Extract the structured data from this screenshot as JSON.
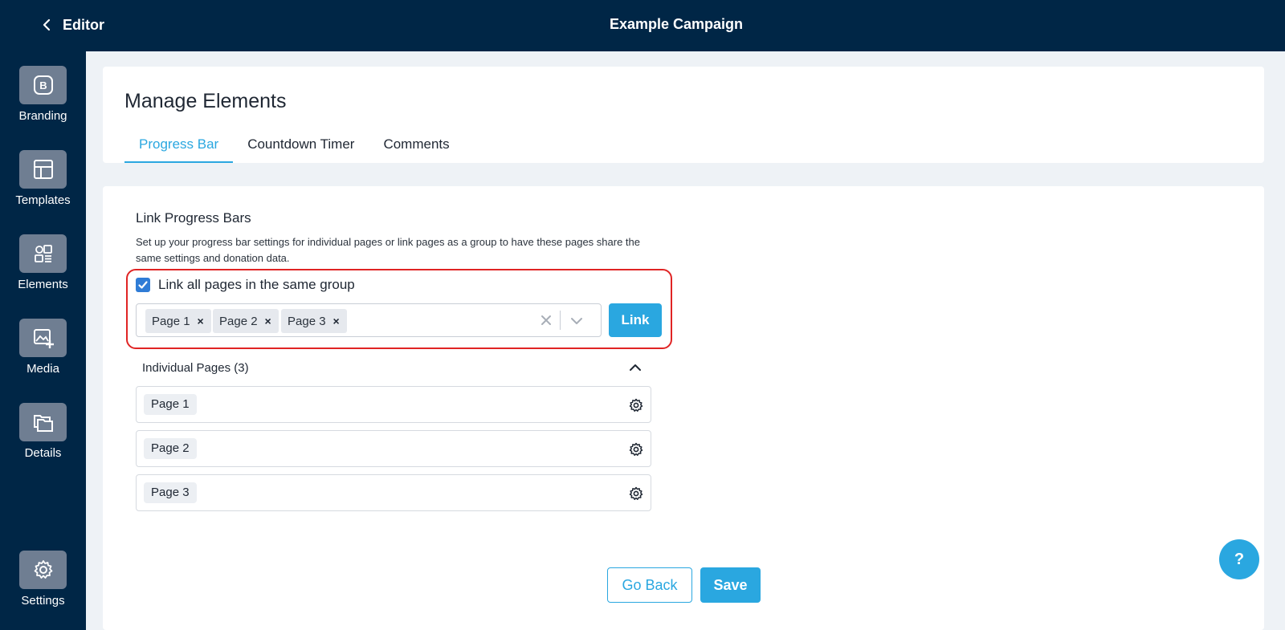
{
  "topbar": {
    "back_label": "Editor",
    "title": "Example Campaign"
  },
  "sidebar": {
    "items": [
      {
        "label": "Branding",
        "icon": "branding-icon"
      },
      {
        "label": "Templates",
        "icon": "templates-icon"
      },
      {
        "label": "Elements",
        "icon": "elements-icon"
      },
      {
        "label": "Media",
        "icon": "media-icon"
      },
      {
        "label": "Details",
        "icon": "details-icon"
      },
      {
        "label": "Settings",
        "icon": "gear-icon"
      }
    ]
  },
  "header": {
    "title": "Manage Elements",
    "tabs": [
      {
        "label": "Progress Bar",
        "active": true
      },
      {
        "label": "Countdown Timer",
        "active": false
      },
      {
        "label": "Comments",
        "active": false
      }
    ]
  },
  "link_section": {
    "title": "Link Progress Bars",
    "description": "Set up your progress bar settings for individual pages or link pages as a group to have these pages share the same settings and donation data.",
    "checkbox_label": "Link all pages in the same group",
    "checkbox_checked": true,
    "selected_tags": [
      "Page 1",
      "Page 2",
      "Page 3"
    ],
    "link_button": "Link"
  },
  "individual": {
    "header": "Individual Pages (3)",
    "pages": [
      "Page 1",
      "Page 2",
      "Page 3"
    ]
  },
  "footer": {
    "back_button": "Go Back",
    "save_button": "Save"
  },
  "help": {
    "label": "?"
  },
  "colors": {
    "navy": "#002646",
    "accent": "#2aa7e0",
    "highlight": "#e02424"
  }
}
